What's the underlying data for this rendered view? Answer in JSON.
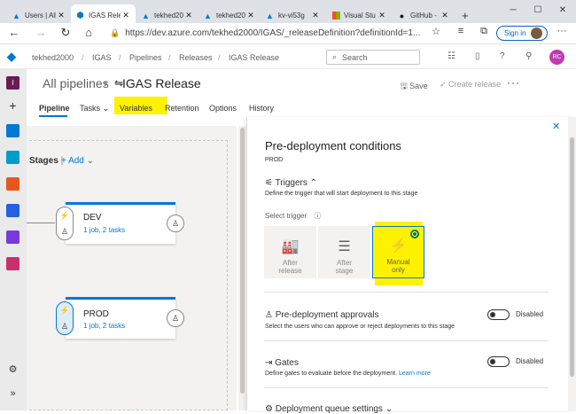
{
  "browser": {
    "tabs": [
      {
        "label": "Users | All",
        "icon": "azure-icon"
      },
      {
        "label": "IGAS Relea",
        "icon": "devops-icon",
        "active": true
      },
      {
        "label": "tekhed20",
        "icon": "azure-icon"
      },
      {
        "label": "tekhed20",
        "icon": "azure-icon"
      },
      {
        "label": "kv-vi53g",
        "icon": "azure-icon"
      },
      {
        "label": "Visual Stu",
        "icon": "microsoft-icon"
      },
      {
        "label": "GitHub -",
        "icon": "github-icon"
      }
    ],
    "new_tab": "+",
    "url": "https://dev.azure.com/tekhed2000/IGAS/_releaseDefinition?definitionId=1...",
    "sign_in": "Sign in"
  },
  "header": {
    "org": "tekhed2000",
    "project": "IGAS",
    "section": "Pipelines",
    "subsection": "Releases",
    "page": "IGAS Release",
    "search_placeholder": "Search",
    "user_initials": "RC"
  },
  "rail": {
    "project_initial": "I"
  },
  "title": {
    "all_pipelines": "All pipelines",
    "release_name": "IGAS Release",
    "save": "Save",
    "create_release": "Create release",
    "more": "···"
  },
  "pivots": [
    "Pipeline",
    "Tasks",
    "Variables",
    "Retention",
    "Options",
    "History"
  ],
  "canvas": {
    "stages_label": "Stages",
    "add_label": "Add",
    "stages": [
      {
        "name": "DEV",
        "summary": "1 job, 2 tasks"
      },
      {
        "name": "PROD",
        "summary": "1 job, 2 tasks"
      }
    ]
  },
  "panel": {
    "title": "Pre-deployment conditions",
    "stage": "PROD",
    "triggers_heading": "Triggers",
    "triggers_desc": "Define the trigger that will start deployment to this stage",
    "select_trigger": "Select trigger",
    "options": [
      {
        "label": "After release"
      },
      {
        "label": "After stage"
      },
      {
        "label": "Manual only",
        "selected": true
      }
    ],
    "approvals_heading": "Pre-deployment approvals",
    "approvals_desc": "Select the users who can approve or reject deployments to this stage",
    "approvals_state": "Disabled",
    "gates_heading": "Gates",
    "gates_desc": "Define gates to evaluate before the deployment.",
    "gates_link": "Learn more",
    "gates_state": "Disabled",
    "queue_heading": "Deployment queue settings"
  },
  "colors": {
    "accent": "#0078d4",
    "highlight": "#fff200",
    "selected_dot": "#107c10"
  }
}
